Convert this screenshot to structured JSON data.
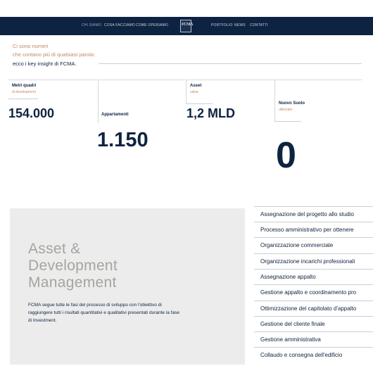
{
  "nav": {
    "left_items": [
      "CHI SIAMO",
      "COSA FACCIAMO",
      "COME OPERIAMO"
    ],
    "right_items": [
      "PORTFOLIO",
      "NEWS",
      "CONTATTI"
    ],
    "logo_text": "FCMA"
  },
  "intro": {
    "line1": "Ci sono numeri",
    "line2": "che contano più di qualsiasi parola:",
    "line3": "ecco i key insight di FCMA."
  },
  "stats": [
    {
      "label": "Metri quadri",
      "sub": "di development",
      "value": "154.000"
    },
    {
      "label": "Appartamenti",
      "sub": "",
      "value": "1.150"
    },
    {
      "label": "Asset",
      "sub": "value",
      "value": "1,2 MLD"
    },
    {
      "label": "Nuovo Suolo",
      "sub": "utilizzato",
      "value": "0"
    }
  ],
  "panel": {
    "title_line1": "Asset &",
    "title_line2": "Development",
    "title_line3": "Management",
    "body_line1": "FCMA segue tutte le fasi del processo di sviluppo con l'obiettivo di",
    "body_line2": "raggiungere tutti i risultati quantitativi e qualitativi presentati durante la fase",
    "body_line3": "di Investment."
  },
  "process_steps": [
    "Assegnazione del progetto allo studio",
    "Processo amministrativo per ottenere",
    "Organizzazione commerciale",
    "Organizzazione incarichi professionali",
    "Assegnazione appalto",
    "Gestione appalto e coordinamento pro",
    "Ottimizzazione del capitolato d'appalto",
    "Gestione del cliente finale",
    "Gestione amministrativa",
    "Collaudo e consegna dell'edificio"
  ],
  "colors": {
    "navy": "#0e2341",
    "accent_copper": "#c08a63",
    "panel_grey": "#ececec"
  }
}
